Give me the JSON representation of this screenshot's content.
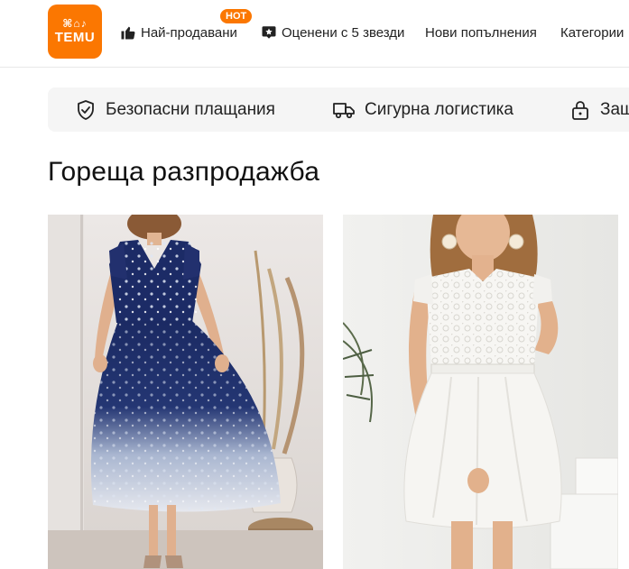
{
  "logo": {
    "glyphs": "⌘⌂♪",
    "text": "TEMU"
  },
  "nav": {
    "items": [
      {
        "label": "Най-продавани",
        "icon": "thumbs-up-icon"
      },
      {
        "label": "Оценени с 5 звезди",
        "icon": "star-badge-icon"
      },
      {
        "label": "Нови попълнения"
      },
      {
        "label": "Категории"
      }
    ],
    "hot_badge": "HOT"
  },
  "trust": {
    "items": [
      {
        "label": "Безопасни плащания",
        "icon": "shield-check-icon"
      },
      {
        "label": "Сигурна логистика",
        "icon": "truck-icon"
      },
      {
        "label": "Защ",
        "icon": "lock-icon"
      }
    ]
  },
  "section": {
    "title": "Гореща разпродажба"
  },
  "colors": {
    "brand": "#fb7701",
    "trust_bg": "#f5f5f5"
  }
}
